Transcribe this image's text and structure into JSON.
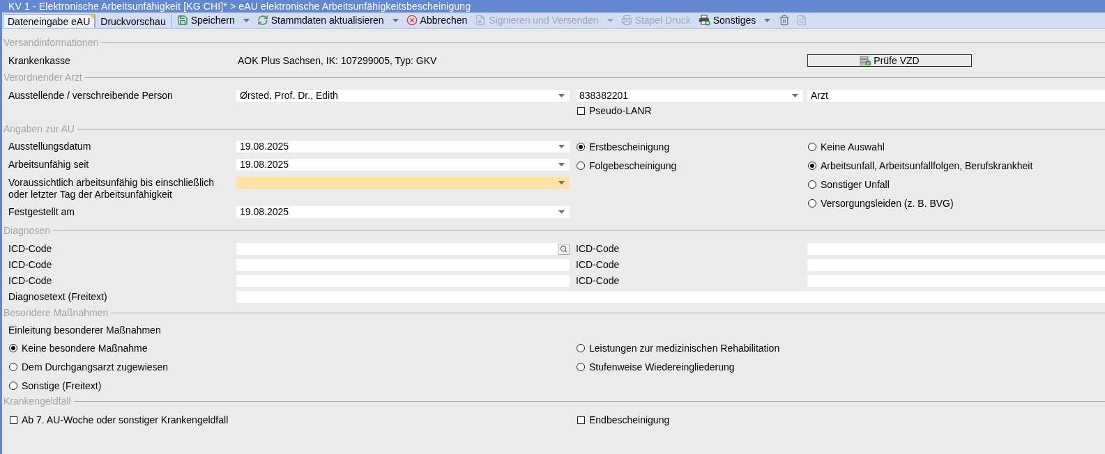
{
  "window": {
    "title": "KV 1 - Elektronische Arbeitsunfähigkeit [KG CHI]* > eAU elektronische Arbeitsunfähigkeitsbescheinigung"
  },
  "toolbar": {
    "tabs": [
      {
        "label": "Dateneingabe eAU",
        "selected": true,
        "modified": true
      },
      {
        "label": "Druckvorschau",
        "selected": false,
        "modified": false
      }
    ],
    "buttons": [
      {
        "kind": "save",
        "label": "Speichern",
        "disabled": false,
        "dropdown": true
      },
      {
        "kind": "refresh",
        "label": "Stammdaten aktualisieren",
        "disabled": false,
        "dropdown": true
      },
      {
        "kind": "cancel",
        "label": "Abbrechen",
        "disabled": false,
        "dropdown": false
      },
      {
        "kind": "sign",
        "label": "Signieren und Versenden",
        "disabled": true,
        "dropdown": true
      },
      {
        "kind": "print",
        "label": "Stapel Druck",
        "disabled": true,
        "dropdown": false
      },
      {
        "kind": "more",
        "label": "Sonstiges",
        "disabled": false,
        "dropdown": true
      },
      {
        "kind": "trash",
        "disabled": false,
        "dropdown": false
      },
      {
        "kind": "clock",
        "disabled": true,
        "dropdown": false
      }
    ]
  },
  "versandinformationen": {
    "heading": "Versandinformationen",
    "label": "Krankenkasse",
    "value": "AOK Plus Sachsen, IK: 107299005, Typ: GKV",
    "button": {
      "label": "Prüfe VZD"
    }
  },
  "verordnender_arzt": {
    "heading": "Verordnender Arzt",
    "label": "Ausstellende / verschreibende Person",
    "fields": [
      {
        "kind": "dropdown",
        "value": "Ørsted, Prof. Dr., Edith"
      },
      {
        "kind": "dropdown",
        "value": "838382201"
      },
      {
        "kind": "text",
        "value": "Arzt"
      }
    ],
    "pseudo_lanr": {
      "label": "Pseudo-LANR",
      "checked": false
    }
  },
  "angaben_zur_au": {
    "heading": "Angaben zur AU",
    "dates": [
      {
        "label": "Ausstellungsdatum",
        "value": "19.08.2025",
        "highlighted": false
      },
      {
        "label": "Arbeitsunfähig seit",
        "value": "19.08.2025",
        "highlighted": false
      },
      {
        "label": "Voraussichtlich arbeitsunfähig bis einschließlich\noder letzter Tag der Arbeitsunfähigkeit",
        "highlighted": true
      },
      {
        "label": "Festgestellt am",
        "value": "19.08.2025",
        "highlighted": false
      }
    ],
    "bescheinigung": [
      {
        "label": "Erstbescheinigung",
        "selected": true
      },
      {
        "label": "Folgebescheinigung",
        "selected": false
      }
    ],
    "unfall": [
      {
        "label": "Keine Auswahl",
        "selected": false
      },
      {
        "label": "Arbeitsunfall, Arbeitsunfallfolgen, Berufskrankheit",
        "selected": true
      },
      {
        "label": "Sonstiger Unfall",
        "selected": false
      },
      {
        "label": "Versorgungsleiden (z. B. BVG)",
        "selected": false
      }
    ]
  },
  "diagnosen": {
    "heading": "Diagnosen",
    "icd_codes": [
      {
        "label": "ICD-Code",
        "search": true
      },
      {
        "label": "ICD-Code",
        "search": false
      },
      {
        "label": "ICD-Code",
        "search": false
      },
      {
        "label": "ICD-Code",
        "search": false
      },
      {
        "label": "ICD-Code",
        "search": false
      },
      {
        "label": "ICD-Code",
        "search": false
      }
    ],
    "diagnosetext": {
      "label": "Diagnosetext (Freitext)"
    }
  },
  "besondere_massnahmen": {
    "heading": "Besondere Maßnahmen",
    "intro": "Einleitung besonderer Maßnahmen",
    "options": [
      {
        "label": "Keine besondere Maßnahme",
        "selected": true
      },
      {
        "label": "Leistungen zur medizinischen Rehabilitation",
        "selected": false
      },
      {
        "label": "Dem Durchgangsarzt zugewiesen",
        "selected": false
      },
      {
        "label": "Stufenweise Wiedereingliederung",
        "selected": false
      },
      {
        "label": "Sonstige (Freitext)",
        "selected": false
      }
    ]
  },
  "krankengeldfall": {
    "heading": "Krankengeldfall",
    "options": [
      {
        "label": "Ab 7. AU-Woche oder sonstiger Krankengeldfall",
        "checked": false
      },
      {
        "label": "Endbescheinigung",
        "checked": false
      }
    ]
  }
}
